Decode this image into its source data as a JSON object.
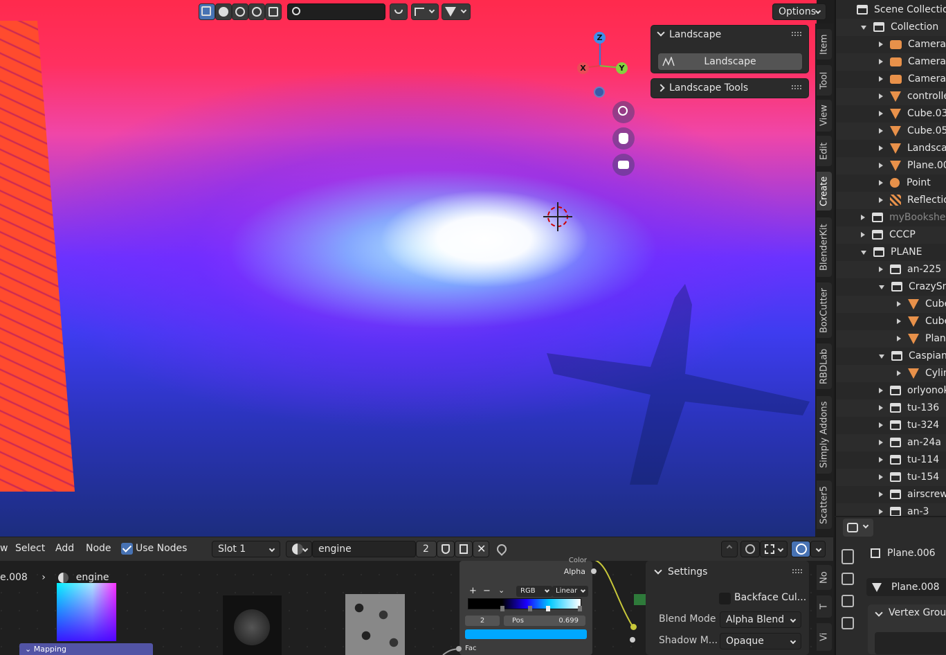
{
  "viewport": {
    "search_placeholder": "",
    "options_label": "Options"
  },
  "gizmo": {
    "z": "Z",
    "x": "X",
    "y": "Y"
  },
  "npanel": {
    "landscape_header": "Landscape",
    "landscape_button": "Landscape",
    "tools_header": "Landscape Tools"
  },
  "side_tabs": [
    "Item",
    "Tool",
    "View",
    "Edit",
    "Create",
    "BlenderKit",
    "BoxCutter",
    "RBDLab",
    "Simply Addons",
    "Scatter5"
  ],
  "outliner": {
    "scene_collection": "Scene Collection",
    "rows": [
      {
        "label": "Collection",
        "type": "collection",
        "expanded": true
      },
      {
        "label": "Camera",
        "type": "camera"
      },
      {
        "label": "Camera.",
        "type": "camera"
      },
      {
        "label": "Camera.",
        "type": "camera"
      },
      {
        "label": "controlle",
        "type": "mesh"
      },
      {
        "label": "Cube.03",
        "type": "mesh"
      },
      {
        "label": "Cube.05",
        "type": "mesh"
      },
      {
        "label": "Landscap",
        "type": "mesh"
      },
      {
        "label": "Plane.00",
        "type": "mesh"
      },
      {
        "label": "Point",
        "type": "light"
      },
      {
        "label": "Reflectio",
        "type": "probe"
      },
      {
        "label": "myBookshel",
        "type": "collection"
      },
      {
        "label": "CCCP",
        "type": "collection"
      },
      {
        "label": "PLANE",
        "type": "collection",
        "expanded": true
      },
      {
        "label": "an-225",
        "type": "collection"
      },
      {
        "label": "CrazySno",
        "type": "collection",
        "expanded": true
      },
      {
        "label": "Cube",
        "type": "mesh"
      },
      {
        "label": "Cube",
        "type": "mesh"
      },
      {
        "label": "Plane",
        "type": "mesh"
      },
      {
        "label": "CaspianS",
        "type": "collection",
        "expanded": true
      },
      {
        "label": "Cylin",
        "type": "mesh"
      },
      {
        "label": "orlyonok",
        "type": "collection"
      },
      {
        "label": "tu-136",
        "type": "collection"
      },
      {
        "label": "tu-324",
        "type": "collection"
      },
      {
        "label": "an-24a",
        "type": "collection"
      },
      {
        "label": "tu-114",
        "type": "collection"
      },
      {
        "label": "tu-154",
        "type": "collection"
      },
      {
        "label": "airscrew_",
        "type": "collection"
      },
      {
        "label": "an-3",
        "type": "collection"
      }
    ]
  },
  "node_editor": {
    "menu_view": "w",
    "menu_select": "Select",
    "menu_add": "Add",
    "menu_node": "Node",
    "use_nodes": "Use Nodes",
    "slot": "Slot 1",
    "material_name": "engine",
    "user_count": "2",
    "breadcrumb_object": "e.008",
    "breadcrumb_material": "engine",
    "mapping_label": "Mapping",
    "ramp_mode": "RGB",
    "ramp_interp": "Linear",
    "stop_index": "2",
    "pos_label": "Pos",
    "pos_value": "0.699",
    "socket_color": "Color",
    "socket_alpha": "Alpha",
    "socket_fac": "Fac",
    "plus": "+",
    "minus": "−"
  },
  "settings_panel": {
    "header": "Settings",
    "backface": "Backface Cul...",
    "blend_mode_label": "Blend Mode",
    "blend_mode_value": "Alpha Blend",
    "shadow_mode_label": "Shadow M...",
    "shadow_mode_value": "Opaque"
  },
  "node_side_tabs": [
    "No",
    "T",
    "Vi"
  ],
  "properties": {
    "object_name": "Plane.006",
    "mesh_name": "Plane.008",
    "vertex_groups": "Vertex Groups"
  },
  "colors": {
    "accent": "#4772b3",
    "ramp_stop": "#00a8ff"
  }
}
